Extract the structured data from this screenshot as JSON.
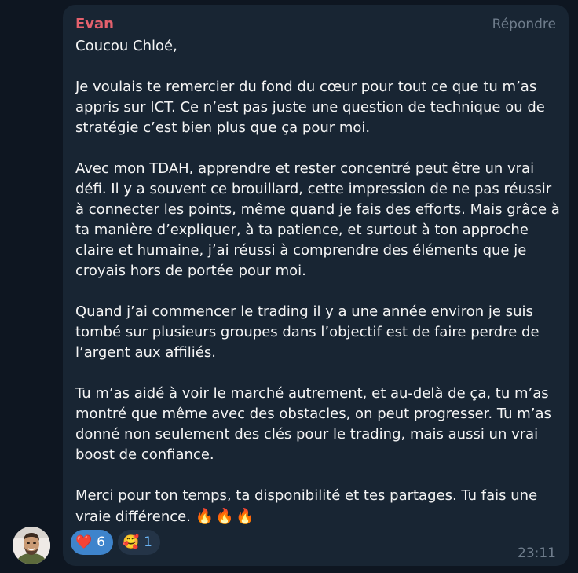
{
  "message": {
    "sender": "Evan",
    "reply_label": "Répondre",
    "paragraphs": [
      [
        "Coucou Chloé,"
      ],
      [
        "Je voulais te remercier du fond du cœur pour tout ce que tu m’as",
        "appris sur ICT. Ce n’est pas juste une question de technique ou de",
        "stratégie c’est bien plus que ça pour moi."
      ],
      [
        "Avec mon TDAH, apprendre et rester concentré peut être un vrai",
        "défi. Il y a souvent ce brouillard, cette impression de ne pas réussir",
        "à connecter les points, même quand je fais des efforts. Mais grâce à",
        "ta manière d’expliquer, à ta patience, et surtout à ton approche",
        "claire et humaine, j’ai réussi à comprendre des éléments que je",
        "croyais hors de portée pour moi."
      ],
      [
        "Quand j’ai commencer le trading il y a une année environ je suis",
        "tombé sur plusieurs groupes dans l’objectif est de faire perdre de",
        "l’argent aux affiliés."
      ],
      [
        "Tu m’as aidé à voir le marché autrement, et au-delà de ça, tu m’as",
        "montré que même avec des obstacles, on peut progresser. Tu m’as",
        "donné non seulement des clés pour le trading, mais aussi un vrai",
        "boost de confiance."
      ],
      [
        "Merci pour ton temps, ta disponibilité et tes partages. Tu fais une",
        "vraie différence."
      ]
    ],
    "closing_emoji": "🔥🔥🔥",
    "time": "23:11",
    "reactions": [
      {
        "emoji": "❤️",
        "count": "6",
        "active": true
      },
      {
        "emoji": "🥰",
        "count": "1",
        "active": false
      }
    ]
  },
  "colors": {
    "background": "#0e1621",
    "bubble": "#182533",
    "sender": "#e4616d",
    "reaction_active": "#3e84cc"
  },
  "icons": {
    "avatar": "user-avatar-photo"
  }
}
